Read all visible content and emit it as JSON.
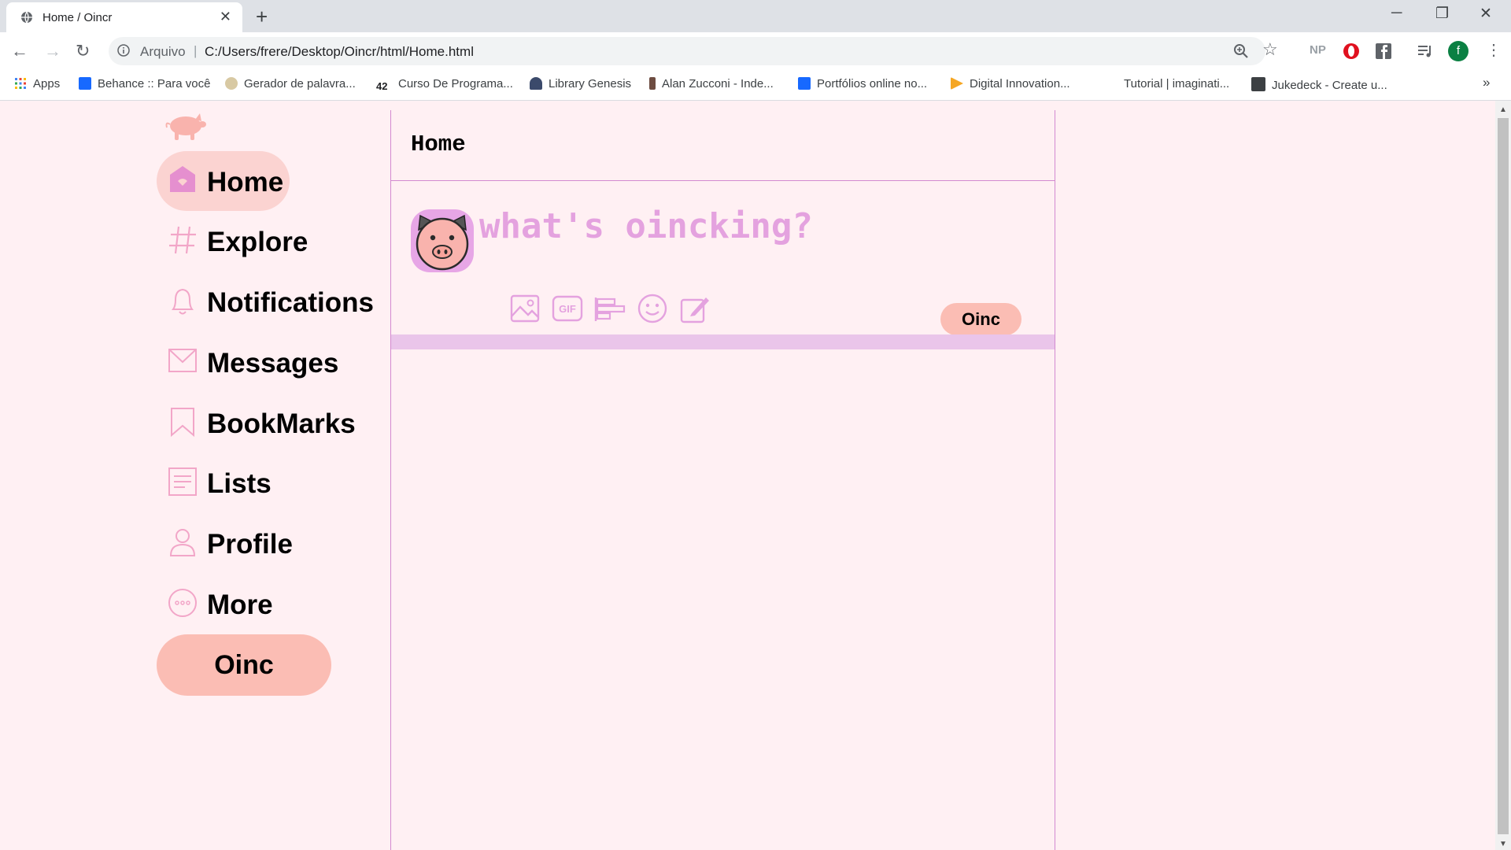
{
  "browser": {
    "tab_title": "Home / Oincr",
    "close_glyph": "✕",
    "new_tab_glyph": "+",
    "window_controls": [
      "─",
      "❐",
      "✕"
    ],
    "nav": {
      "back": "←",
      "forward": "→",
      "reload": "↻"
    },
    "omnibox": {
      "scheme_label": "Arquivo",
      "separator": "|",
      "url": "C:/Users/frere/Desktop/Oincr/html/Home.html",
      "star_glyph": "☆"
    },
    "extensions": [
      "NP",
      "opera-icon",
      "facebook-icon",
      "reading-list-icon",
      "f",
      "⋮"
    ],
    "bookmarks": [
      {
        "label": "Apps",
        "icon": "apps-grid-icon"
      },
      {
        "label": "Behance :: Para você",
        "icon": "behance-icon"
      },
      {
        "label": "Gerador de palavra...",
        "icon": "generator-icon"
      },
      {
        "label": "Curso De Programa...",
        "icon": "course-icon"
      },
      {
        "label": "Library Genesis",
        "icon": "library-icon"
      },
      {
        "label": "Alan Zucconi - Inde...",
        "icon": "person-icon"
      },
      {
        "label": "Portfólios online no...",
        "icon": "behance-icon"
      },
      {
        "label": "Digital Innovation...",
        "icon": "dio-icon"
      },
      {
        "label": "Tutorial | imaginati...",
        "icon": ""
      },
      {
        "label": "Jukedeck - Create u...",
        "icon": "jukedeck-icon"
      }
    ],
    "bookmarks_overflow": "»"
  },
  "colors": {
    "page_bg": "#fff0f3",
    "accent_pink": "#fbbdb4",
    "active_bg": "#fbd3d1",
    "icon_pink": "#f2a6c8",
    "border_purple": "#d38ad0",
    "compose_text": "#e4a2df"
  },
  "sidebar": {
    "logo_icon": "pig-logo-icon",
    "items": [
      {
        "label": "Home",
        "icon": "house-icon",
        "active": true
      },
      {
        "label": "Explore",
        "icon": "hashtag-icon",
        "active": false
      },
      {
        "label": "Notifications",
        "icon": "bell-icon",
        "active": false
      },
      {
        "label": "Messages",
        "icon": "envelope-icon",
        "active": false
      },
      {
        "label": "BookMarks",
        "icon": "bookmark-icon",
        "active": false
      },
      {
        "label": "Lists",
        "icon": "list-icon",
        "active": false
      },
      {
        "label": "Profile",
        "icon": "user-icon",
        "active": false
      },
      {
        "label": "More",
        "icon": "more-icon",
        "active": false
      }
    ],
    "oinc_button": "Oinc"
  },
  "feed": {
    "title": "Home",
    "compose_placeholder": "what's oincking?",
    "avatar_icon": "pig-avatar-icon",
    "toolbar_icons": [
      "image-icon",
      "gif-icon",
      "poll-icon",
      "emoji-icon",
      "schedule-icon"
    ],
    "gif_label": "GIF",
    "oinc_button": "Oinc"
  }
}
